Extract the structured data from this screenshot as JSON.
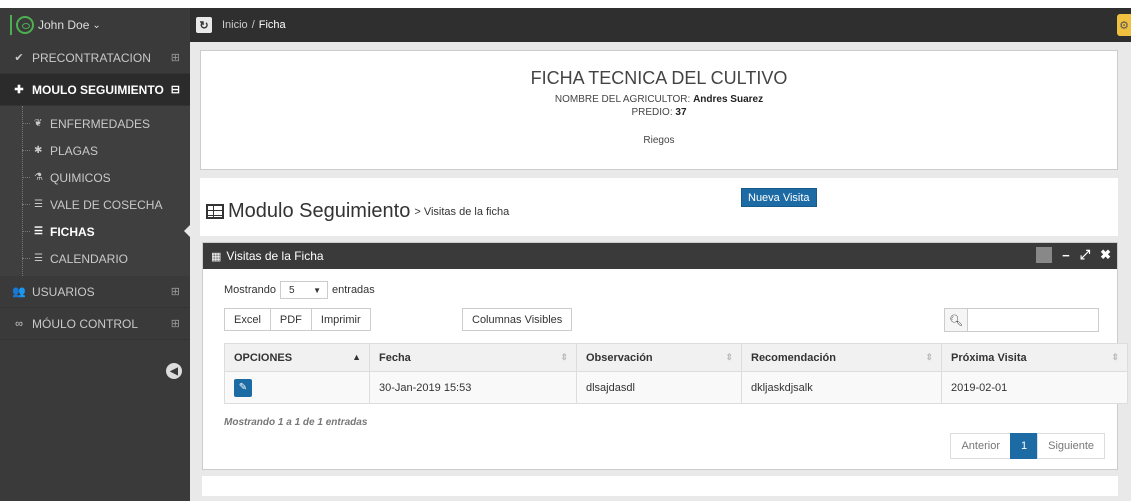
{
  "topbar": {
    "user_name": "John Doe",
    "user_caret": "⌄",
    "breadcrumb_home": "Inicio",
    "breadcrumb_sep": "/",
    "breadcrumb_current": "Ficha"
  },
  "sidebar": {
    "items": [
      {
        "label": "PRECONTRATACION",
        "icon": "check-icon",
        "glyph": "✔",
        "toggle": "⊞"
      },
      {
        "label": "MOULO SEGUIMIENTO",
        "icon": "plus-icon",
        "glyph": "✚",
        "toggle": "⊟"
      },
      {
        "label": "USUARIOS",
        "icon": "users-icon",
        "glyph": "👥",
        "toggle": "⊞"
      },
      {
        "label": "MÓULO CONTROL",
        "icon": "infinity-icon",
        "glyph": "∞",
        "toggle": "⊞"
      }
    ],
    "submenu": [
      {
        "label": "ENFERMEDADES",
        "icon": "leaf-icon",
        "glyph": "❦"
      },
      {
        "label": "PLAGAS",
        "icon": "bug-icon",
        "glyph": "✱"
      },
      {
        "label": "QUIMICOS",
        "icon": "flask-icon",
        "glyph": "⚗"
      },
      {
        "label": "VALE DE COSECHA",
        "icon": "list-icon",
        "glyph": "☰"
      },
      {
        "label": "FICHAS",
        "icon": "list-icon",
        "glyph": "☰"
      },
      {
        "label": "CALENDARIO",
        "icon": "list-icon",
        "glyph": "☰"
      }
    ]
  },
  "ficha": {
    "title": "FICHA TECNICA DEL CULTIVO",
    "agricultor_label": "NOMBRE DEL AGRICULTOR:",
    "agricultor_value": "Andres Suarez",
    "predio_label": "PREDIO:",
    "predio_value": "37",
    "riegos": "Riegos"
  },
  "module": {
    "title": "Modulo Seguimiento",
    "subtitle": "> Visitas de la ficha",
    "new_button": "Nueva Visita"
  },
  "widget": {
    "title": "Visitas de la Ficha",
    "show_label": "Mostrando",
    "page_size": "5",
    "entries_label": "entradas",
    "buttons": [
      "Excel",
      "PDF",
      "Imprimir"
    ],
    "columns_button": "Columnas Visibles",
    "search_value": "",
    "columns": [
      "OPCIONES",
      "Fecha",
      "Observación",
      "Recomendación",
      "Próxima Visita"
    ],
    "rows": [
      {
        "fecha": "30-Jan-2019 15:53",
        "observacion": "dlsajdasdl",
        "recomendacion": "dkljaskdjsalk",
        "proxima": "2019-02-01"
      }
    ],
    "info": "Mostrando 1 a 1 de 1 entradas",
    "pager": {
      "prev": "Anterior",
      "page": "1",
      "next": "Siguiente"
    }
  }
}
